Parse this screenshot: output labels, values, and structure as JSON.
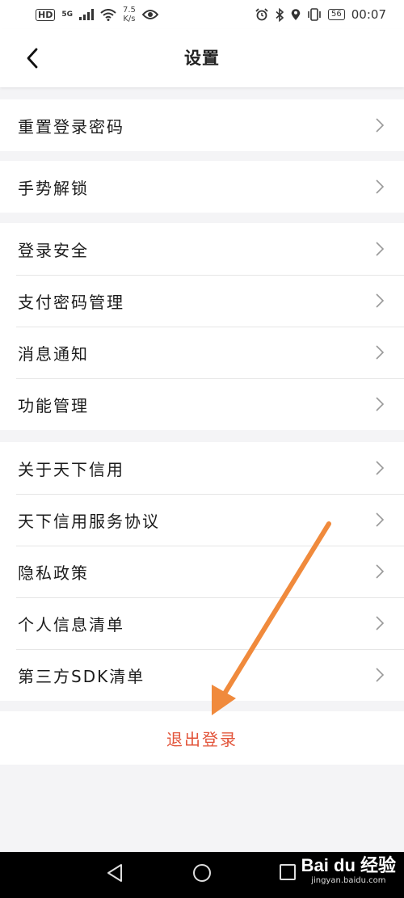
{
  "status_bar": {
    "network_type": "HD",
    "signal_gen": "5G",
    "speed_value": "7.5",
    "speed_unit": "K/s",
    "battery": "56",
    "time": "00:07",
    "icons": [
      "signal-icon",
      "wifi-icon",
      "eye-icon",
      "alarm-icon",
      "bluetooth-icon",
      "location-icon",
      "vibrate-icon",
      "battery-icon"
    ]
  },
  "nav": {
    "title": "设置",
    "back_icon": "chevron-left-icon"
  },
  "groups": [
    {
      "items": [
        {
          "label": "重置登录密码"
        }
      ]
    },
    {
      "items": [
        {
          "label": "手势解锁"
        }
      ]
    },
    {
      "items": [
        {
          "label": "登录安全"
        },
        {
          "label": "支付密码管理"
        },
        {
          "label": "消息通知"
        },
        {
          "label": "功能管理"
        }
      ]
    },
    {
      "items": [
        {
          "label": "关于天下信用"
        },
        {
          "label": "天下信用服务协议"
        },
        {
          "label": "隐私政策"
        },
        {
          "label": "个人信息清单"
        },
        {
          "label": "第三方SDK清单"
        }
      ]
    }
  ],
  "logout": {
    "label": "退出登录"
  },
  "colors": {
    "logout_text": "#e2543a",
    "annotation_arrow": "#f08a3c",
    "background": "#f4f4f6"
  },
  "watermark": {
    "main": "Bai du 经验",
    "sub": "jingyan.baidu.com"
  }
}
